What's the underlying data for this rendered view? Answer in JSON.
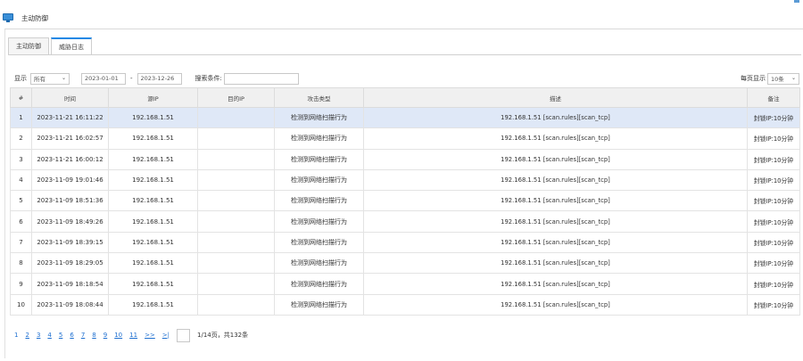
{
  "window": {
    "title": "主动防御"
  },
  "tabs": [
    {
      "label": "主动防御",
      "active": false
    },
    {
      "label": "威胁日志",
      "active": true
    }
  ],
  "filter": {
    "show_label": "显示",
    "show_value": "所有",
    "date_from": "2023-01-01",
    "date_sep": "-",
    "date_to": "2023-12-26",
    "search_label": "搜索条件:",
    "search_value": "",
    "per_page_label": "每页显示",
    "per_page_value": "10条"
  },
  "table": {
    "columns": [
      "#",
      "时间",
      "源IP",
      "目的IP",
      "攻击类型",
      "描述",
      "备注"
    ],
    "rows": [
      [
        "1",
        "2023-11-21  16:11:22",
        "192.168.1.51",
        "",
        "检测到网络扫描行为",
        "192.168.1.51  [scan.rules][scan_tcp]",
        "封锁IP:10分钟"
      ],
      [
        "2",
        "2023-11-21  16:02:57",
        "192.168.1.51",
        "",
        "检测到网络扫描行为",
        "192.168.1.51  [scan.rules][scan_tcp]",
        "封锁IP:10分钟"
      ],
      [
        "3",
        "2023-11-21  16:00:12",
        "192.168.1.51",
        "",
        "检测到网络扫描行为",
        "192.168.1.51  [scan.rules][scan_tcp]",
        "封锁IP:10分钟"
      ],
      [
        "4",
        "2023-11-09  19:01:46",
        "192.168.1.51",
        "",
        "检测到网络扫描行为",
        "192.168.1.51  [scan.rules][scan_tcp]",
        "封锁IP:10分钟"
      ],
      [
        "5",
        "2023-11-09  18:51:36",
        "192.168.1.51",
        "",
        "检测到网络扫描行为",
        "192.168.1.51  [scan.rules][scan_tcp]",
        "封锁IP:10分钟"
      ],
      [
        "6",
        "2023-11-09  18:49:26",
        "192.168.1.51",
        "",
        "检测到网络扫描行为",
        "192.168.1.51  [scan.rules][scan_tcp]",
        "封锁IP:10分钟"
      ],
      [
        "7",
        "2023-11-09  18:39:15",
        "192.168.1.51",
        "",
        "检测到网络扫描行为",
        "192.168.1.51  [scan.rules][scan_tcp]",
        "封锁IP:10分钟"
      ],
      [
        "8",
        "2023-11-09  18:29:05",
        "192.168.1.51",
        "",
        "检测到网络扫描行为",
        "192.168.1.51  [scan.rules][scan_tcp]",
        "封锁IP:10分钟"
      ],
      [
        "9",
        "2023-11-09  18:18:54",
        "192.168.1.51",
        "",
        "检测到网络扫描行为",
        "192.168.1.51  [scan.rules][scan_tcp]",
        "封锁IP:10分钟"
      ],
      [
        "10",
        "2023-11-09  18:08:44",
        "192.168.1.51",
        "",
        "检测到网络扫描行为",
        "192.168.1.51  [scan.rules][scan_tcp]",
        "封锁IP:10分钟"
      ]
    ],
    "selected_row": 0
  },
  "pagination": {
    "current": "1",
    "pages": [
      "2",
      "3",
      "4",
      "5",
      "6",
      "7",
      "8",
      "9",
      "10",
      "11"
    ],
    "next_label": ">>",
    "last_label": ">|",
    "info": "1/14页，共132条"
  },
  "colors": {
    "accent": "#1e88e5",
    "link": "#1e6fd0",
    "selected_row": "#dfe8f7"
  },
  "icons": {
    "window_icon": "monitor-icon",
    "dropdown": "chevron-down-icon"
  }
}
